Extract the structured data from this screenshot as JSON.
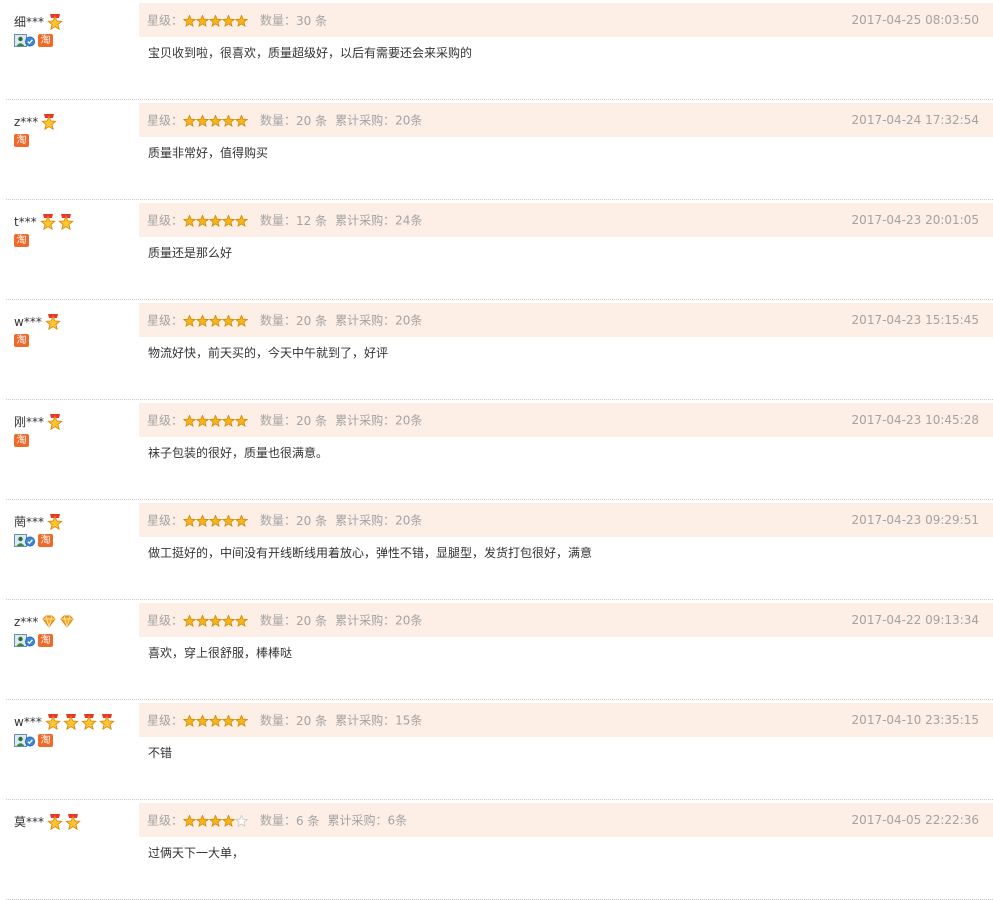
{
  "labels": {
    "star_label": "星级：",
    "qty_label": "数量：",
    "cumulative_label": "累计采购："
  },
  "icons": {
    "user_level_star": "gold-medal-star-icon",
    "user_level_diamond": "diamond-icon",
    "vip": "verified-member-icon",
    "taobao": "tao-icon",
    "tao_text": "淘"
  },
  "colors": {
    "header_bg": "#fdeee6",
    "star": "#f5b51c",
    "tao": "#ef6b2b"
  },
  "reviews": [
    {
      "user": "细***",
      "level_type": "star",
      "level_count": 1,
      "vip": true,
      "rating": 5,
      "qty": "30 条",
      "cumulative": "",
      "date": "2017-04-25 08:03:50",
      "text": "宝贝收到啦，很喜欢，质量超级好，以后有需要还会来采购的"
    },
    {
      "user": "z***",
      "level_type": "star",
      "level_count": 1,
      "vip": false,
      "rating": 5,
      "qty": "20 条",
      "cumulative": "20条",
      "date": "2017-04-24 17:32:54",
      "text": "质量非常好，值得购买"
    },
    {
      "user": "t***",
      "level_type": "star",
      "level_count": 2,
      "vip": false,
      "rating": 5,
      "qty": "12 条",
      "cumulative": "24条",
      "date": "2017-04-23 20:01:05",
      "text": "质量还是那么好"
    },
    {
      "user": "w***",
      "level_type": "star",
      "level_count": 1,
      "vip": false,
      "rating": 5,
      "qty": "20 条",
      "cumulative": "20条",
      "date": "2017-04-23 15:15:45",
      "text": "物流好快，前天买的，今天中午就到了，好评"
    },
    {
      "user": "刚***",
      "level_type": "star",
      "level_count": 1,
      "vip": false,
      "rating": 5,
      "qty": "20 条",
      "cumulative": "20条",
      "date": "2017-04-23 10:45:28",
      "text": "袜子包装的很好，质量也很满意。"
    },
    {
      "user": "菵***",
      "level_type": "star",
      "level_count": 1,
      "vip": true,
      "rating": 5,
      "qty": "20 条",
      "cumulative": "20条",
      "date": "2017-04-23 09:29:51",
      "text": "做工挺好的，中间没有开线断线用着放心，弹性不错，显腿型，发货打包很好，满意"
    },
    {
      "user": "z***",
      "level_type": "diamond",
      "level_count": 2,
      "vip": true,
      "rating": 5,
      "qty": "20 条",
      "cumulative": "20条",
      "date": "2017-04-22 09:13:34",
      "text": "喜欢，穿上很舒服，棒棒哒"
    },
    {
      "user": "w***",
      "level_type": "star",
      "level_count": 4,
      "vip": true,
      "rating": 5,
      "qty": "20 条",
      "cumulative": "15条",
      "date": "2017-04-10 23:35:15",
      "text": "不错"
    },
    {
      "user": "莫***",
      "level_type": "star",
      "level_count": 2,
      "vip": false,
      "tao": false,
      "rating": 4,
      "qty": "6 条",
      "cumulative": "6条",
      "date": "2017-04-05 22:22:36",
      "text": "过俩天下一大单，"
    }
  ]
}
